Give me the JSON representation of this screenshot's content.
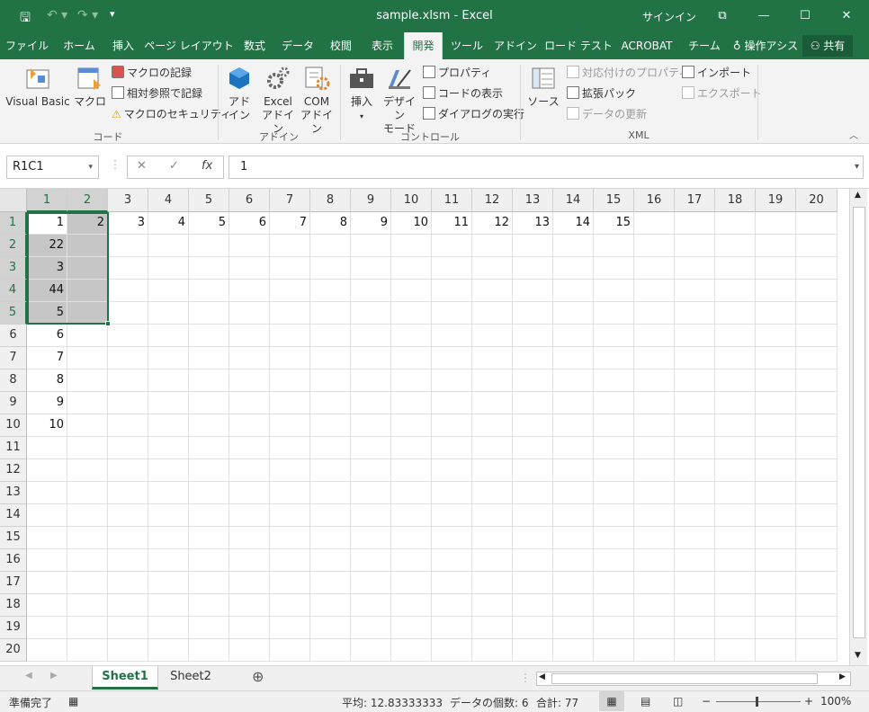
{
  "window": {
    "title": "sample.xlsm  -  Excel",
    "signin": "サインイン"
  },
  "ribbon_tabs": [
    "ファイル",
    "ホーム",
    "挿入",
    "ページ レイアウト",
    "数式",
    "データ",
    "校閲",
    "表示",
    "開発",
    "ツール",
    "アドイン",
    "ロード テスト",
    "ACROBAT",
    "チーム",
    "操作アシス"
  ],
  "share_label": "共有",
  "ribbon": {
    "code": {
      "visual_basic": "Visual Basic",
      "macro": "マクロ",
      "record": "マクロの記録",
      "relative": "相対参照で記録",
      "security": "マクロのセキュリティ",
      "label": "コード"
    },
    "addins": {
      "addin_1": "アド",
      "addin_2": "イン",
      "excel_1": "Excel",
      "excel_2": "アドイン",
      "com_1": "COM",
      "com_2": "アドイン",
      "label": "アドイン"
    },
    "controls": {
      "insert": "挿入",
      "design_1": "デザイン",
      "design_2": "モード",
      "properties": "プロパティ",
      "view_code": "コードの表示",
      "run_dialog": "ダイアログの実行",
      "label": "コントロール"
    },
    "xml": {
      "source": "ソース",
      "map_props": "対応付けのプロパティ",
      "expansion": "拡張パック",
      "refresh": "データの更新",
      "import": "インポート",
      "export": "エクスポート",
      "label": "XML"
    }
  },
  "formula_bar": {
    "name_box": "R1C1",
    "value": "1",
    "fx": "fx"
  },
  "grid": {
    "columns": [
      "1",
      "2",
      "3",
      "4",
      "5",
      "6",
      "7",
      "8",
      "9",
      "10",
      "11",
      "12",
      "13",
      "14",
      "15",
      "16",
      "17",
      "18",
      "19",
      "20"
    ],
    "rows": [
      "1",
      "2",
      "3",
      "4",
      "5",
      "6",
      "7",
      "8",
      "9",
      "10",
      "11",
      "12",
      "13",
      "14",
      "15",
      "16",
      "17",
      "18",
      "19",
      "20"
    ],
    "row1": [
      "1",
      "2",
      "3",
      "4",
      "5",
      "6",
      "7",
      "8",
      "9",
      "10",
      "11",
      "12",
      "13",
      "14",
      "15"
    ],
    "col1": [
      "1",
      "22",
      "3",
      "44",
      "5",
      "6",
      "7",
      "8",
      "9",
      "10"
    ]
  },
  "sheets": [
    "Sheet1",
    "Sheet2"
  ],
  "status": {
    "ready": "準備完了",
    "average": "平均: 12.83333333",
    "count": "データの個数: 6",
    "sum": "合計: 77",
    "zoom": "100%"
  }
}
